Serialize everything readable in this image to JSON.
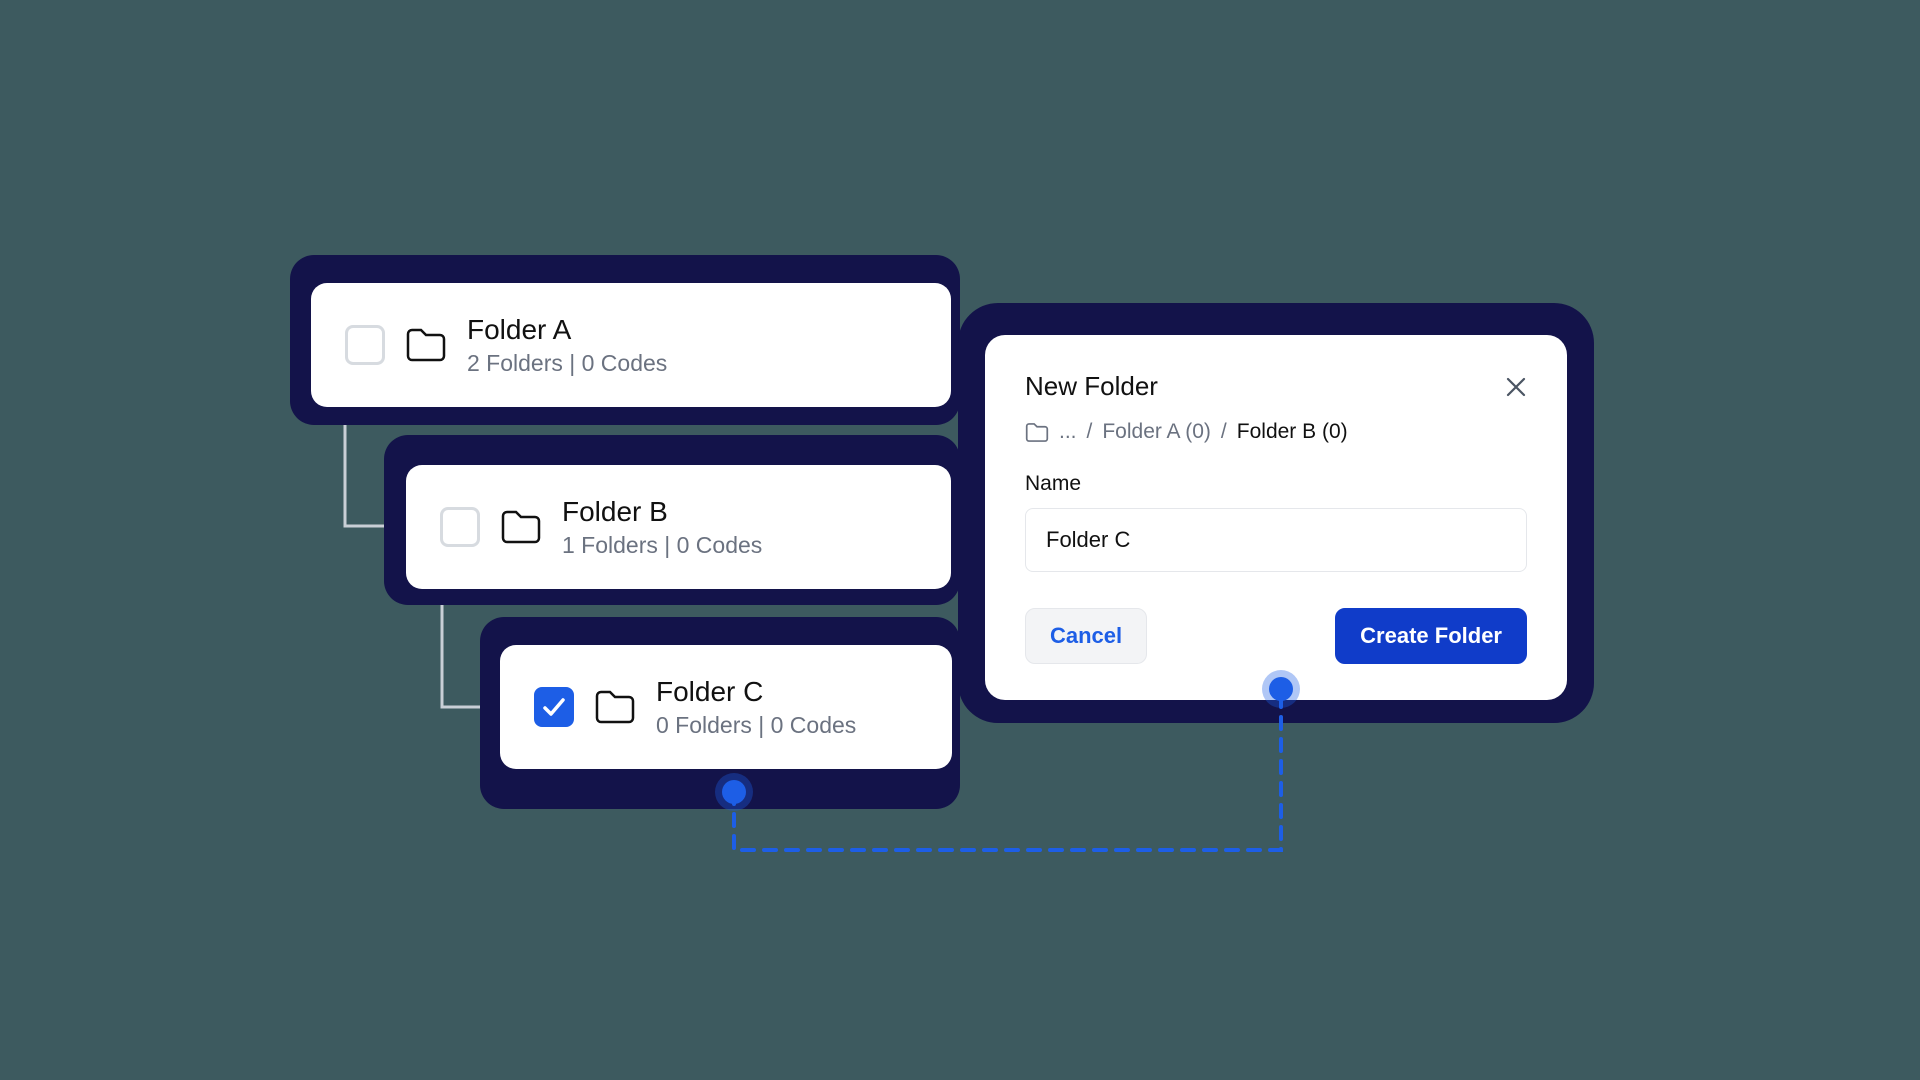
{
  "tree": {
    "items": [
      {
        "title": "Folder A",
        "subtitle": "2 Folders | 0 Codes",
        "checked": false
      },
      {
        "title": "Folder B",
        "subtitle": "1 Folders | 0 Codes",
        "checked": false
      },
      {
        "title": "Folder C",
        "subtitle": "0 Folders | 0 Codes",
        "checked": true
      }
    ]
  },
  "dialog": {
    "title": "New Folder",
    "breadcrumb": {
      "ellipsis": "...",
      "sep": "/",
      "parent1": "Folder A (0)",
      "parent2": "Folder B (0)"
    },
    "name_label": "Name",
    "name_value": "Folder C",
    "cancel_label": "Cancel",
    "create_label": "Create Folder"
  },
  "colors": {
    "accent": "#1d5ee6",
    "shadow": "#13134a",
    "primary_btn": "#103cc9"
  }
}
